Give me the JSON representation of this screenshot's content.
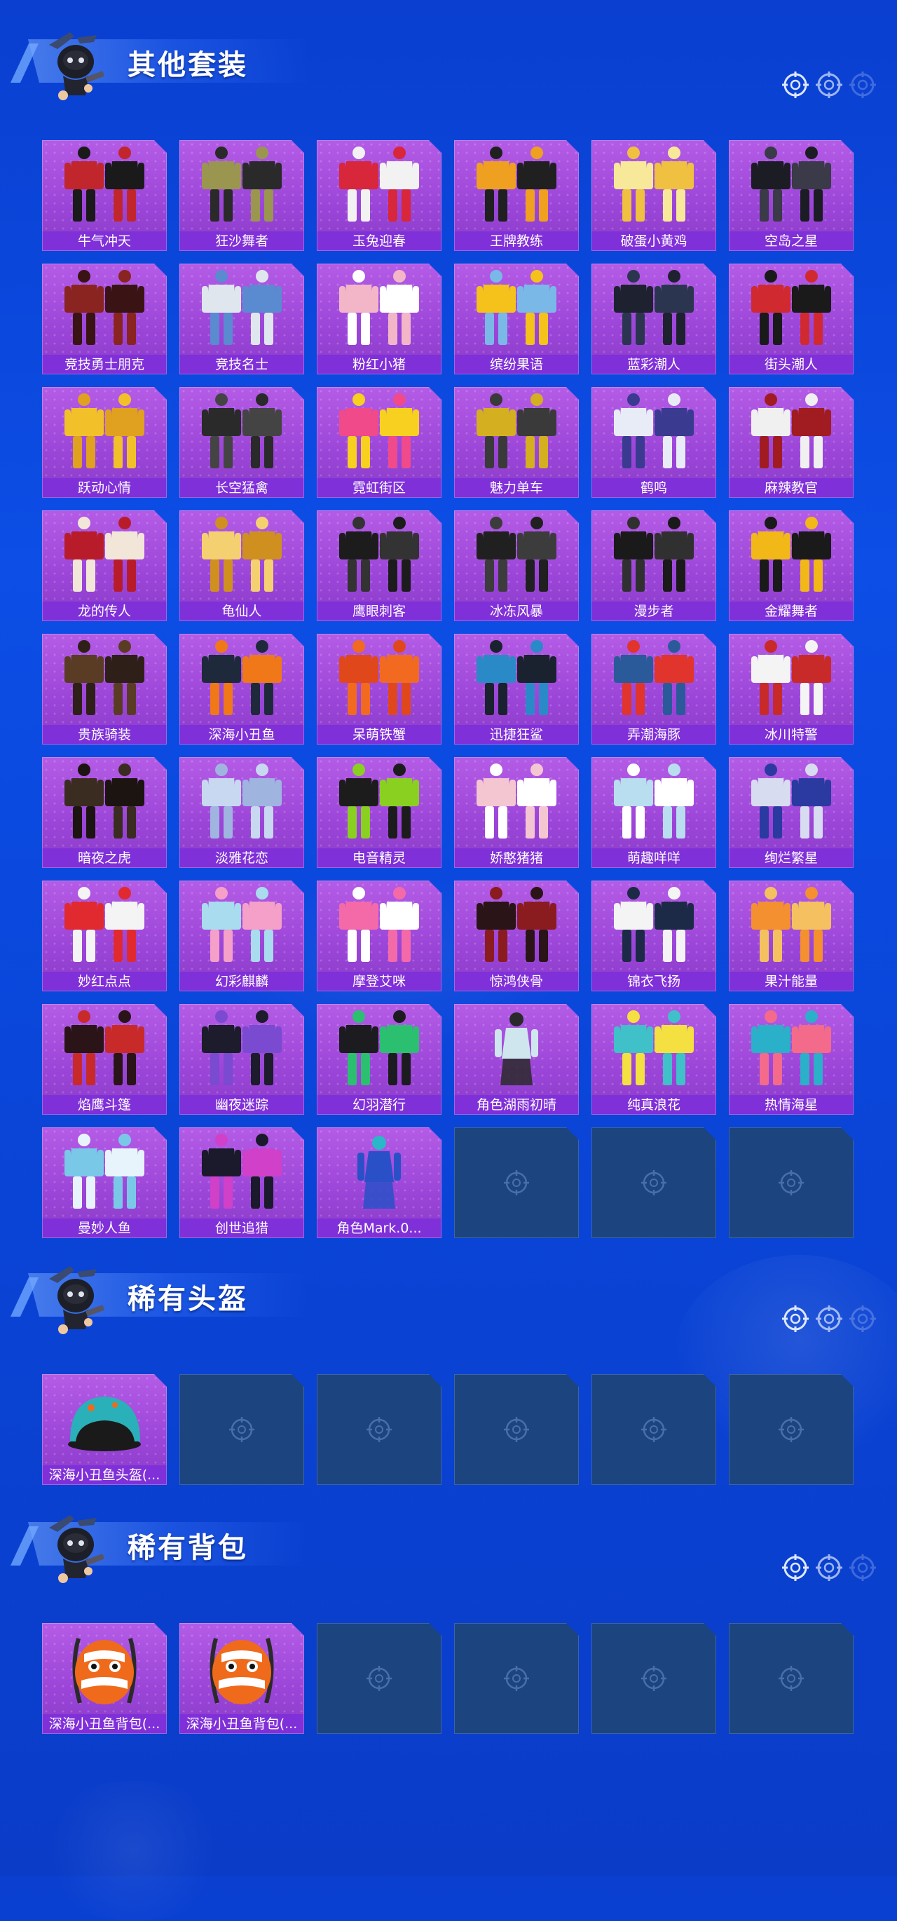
{
  "sections": [
    {
      "id": "suits",
      "title": "其他套装",
      "items": [
        {
          "label": "牛气冲天",
          "icon": "red-black-outfit",
          "primary": "#c0262b",
          "secondary": "#1a1a1a"
        },
        {
          "label": "狂沙舞者",
          "icon": "desert-outfit",
          "primary": "#9a9650",
          "secondary": "#2a2a2a"
        },
        {
          "label": "玉兔迎春",
          "icon": "rabbit-outfit",
          "primary": "#d8263a",
          "secondary": "#f2f2f2"
        },
        {
          "label": "王牌教练",
          "icon": "coach-outfit",
          "primary": "#f0a020",
          "secondary": "#202020"
        },
        {
          "label": "破蛋小黄鸡",
          "icon": "chick-outfit",
          "primary": "#f7e89a",
          "secondary": "#f0c040"
        },
        {
          "label": "空岛之星",
          "icon": "sky-outfit",
          "primary": "#1c1c24",
          "secondary": "#3a3a48"
        },
        {
          "label": "竞技勇士朋克",
          "icon": "punk-coat",
          "primary": "#8a2420",
          "secondary": "#3a1414"
        },
        {
          "label": "竞技名士",
          "icon": "athlete-outfit",
          "primary": "#dfe6ee",
          "secondary": "#5a8ad0"
        },
        {
          "label": "粉红小猪",
          "icon": "pig-outfit",
          "primary": "#f2b6c8",
          "secondary": "#ffffff"
        },
        {
          "label": "缤纷果语",
          "icon": "fruit-outfit",
          "primary": "#f4c21a",
          "secondary": "#7ab8e8"
        },
        {
          "label": "蓝彩潮人",
          "icon": "blue-trend-outfit",
          "primary": "#1e2230",
          "secondary": "#2b3550"
        },
        {
          "label": "街头潮人",
          "icon": "street-outfit",
          "primary": "#d02a30",
          "secondary": "#1a1a1a"
        },
        {
          "label": "跃动心情",
          "icon": "yellow-outfit",
          "primary": "#f2c12a",
          "secondary": "#e0a020"
        },
        {
          "label": "长空猛禽",
          "icon": "leather-jacket",
          "primary": "#2a2a2a",
          "secondary": "#444444"
        },
        {
          "label": "霓虹街区",
          "icon": "neon-outfit",
          "primary": "#f04a8a",
          "secondary": "#f7d020"
        },
        {
          "label": "魅力单车",
          "icon": "bike-outfit",
          "primary": "#d4b020",
          "secondary": "#3a3a3a"
        },
        {
          "label": "鹤鸣",
          "icon": "hoodie",
          "primary": "#e8ecf6",
          "secondary": "#3a3a90"
        },
        {
          "label": "麻辣教官",
          "icon": "instructor-outfit",
          "primary": "#f0f0f0",
          "secondary": "#a01c20"
        },
        {
          "label": "龙的传人",
          "icon": "dragon-outfit",
          "primary": "#b81c2a",
          "secondary": "#f2e6d8"
        },
        {
          "label": "龟仙人",
          "icon": "turtle-shirt",
          "primary": "#f4d070",
          "secondary": "#d09020"
        },
        {
          "label": "鹰眼刺客",
          "icon": "assassin-outfit",
          "primary": "#1c1c1c",
          "secondary": "#333333"
        },
        {
          "label": "冰冻风暴",
          "icon": "storm-outfit",
          "primary": "#202020",
          "secondary": "#3c3c3c"
        },
        {
          "label": "漫步者",
          "icon": "walker-outfit",
          "primary": "#1a1a1a",
          "secondary": "#303030"
        },
        {
          "label": "金耀舞者",
          "icon": "gold-outfit",
          "primary": "#f2b818",
          "secondary": "#1a1a1a"
        },
        {
          "label": "贵族骑装",
          "icon": "noble-outfit",
          "primary": "#5a3c24",
          "secondary": "#2e2018"
        },
        {
          "label": "深海小丑鱼",
          "icon": "clownfish-outfit",
          "primary": "#1e2a3c",
          "secondary": "#f07818"
        },
        {
          "label": "呆萌铁蟹",
          "icon": "crab-outfit",
          "primary": "#e0481c",
          "secondary": "#f26a20"
        },
        {
          "label": "迅捷狂鲨",
          "icon": "shark-outfit",
          "primary": "#2a8ac8",
          "secondary": "#1a2230"
        },
        {
          "label": "弄潮海豚",
          "icon": "dolphin-outfit",
          "primary": "#2a5a9a",
          "secondary": "#e0342c"
        },
        {
          "label": "冰川特警",
          "icon": "glacier-outfit",
          "primary": "#f4f4f4",
          "secondary": "#c82a2a"
        },
        {
          "label": "暗夜之虎",
          "icon": "night-tiger",
          "primary": "#3a2c20",
          "secondary": "#1c1410"
        },
        {
          "label": "淡雅花恋",
          "icon": "floral-dress",
          "primary": "#c8d8f0",
          "secondary": "#a0b4e0"
        },
        {
          "label": "电音精灵",
          "icon": "edm-outfit",
          "primary": "#1c1c1c",
          "secondary": "#8ad020"
        },
        {
          "label": "娇憨猪猪",
          "icon": "cute-pig",
          "primary": "#f4c6d2",
          "secondary": "#ffffff"
        },
        {
          "label": "萌趣咩咩",
          "icon": "sheep-outfit",
          "primary": "#b8def0",
          "secondary": "#ffffff"
        },
        {
          "label": "绚烂繁星",
          "icon": "star-outfit",
          "primary": "#d8dcf0",
          "secondary": "#2a3aa0"
        },
        {
          "label": "妙红点点",
          "icon": "red-dots",
          "primary": "#e02a30",
          "secondary": "#f4f4f4"
        },
        {
          "label": "幻彩麒麟",
          "icon": "qilin-outfit",
          "primary": "#a8dcee",
          "secondary": "#f4a0c8"
        },
        {
          "label": "摩登艾咪",
          "icon": "modern-outfit",
          "primary": "#f46aa8",
          "secondary": "#ffffff"
        },
        {
          "label": "惊鸿侠骨",
          "icon": "hero-robe",
          "primary": "#2a1418",
          "secondary": "#8a1c20"
        },
        {
          "label": "锦衣飞扬",
          "icon": "brocade-robe",
          "primary": "#f4f4f4",
          "secondary": "#1c2a48"
        },
        {
          "label": "果汁能量",
          "icon": "juice-outfit",
          "primary": "#f49030",
          "secondary": "#f4c060"
        },
        {
          "label": "焰鹰斗篷",
          "icon": "flame-cloak",
          "primary": "#2a1418",
          "secondary": "#c82a2a"
        },
        {
          "label": "幽夜迷踪",
          "icon": "night-trail",
          "primary": "#1c1c2c",
          "secondary": "#7a4ad0"
        },
        {
          "label": "幻羽潜行",
          "icon": "feather-stealth",
          "primary": "#1c1c20",
          "secondary": "#2ac070"
        },
        {
          "label": "角色湖雨初晴",
          "icon": "character-figure",
          "primary": "#cfe6ef",
          "secondary": "#2a2a2a"
        },
        {
          "label": "纯真浪花",
          "icon": "wave-outfit",
          "primary": "#40c0c8",
          "secondary": "#f4e040"
        },
        {
          "label": "热情海星",
          "icon": "starfish-outfit",
          "primary": "#2ab0c8",
          "secondary": "#f46a8a"
        },
        {
          "label": "曼妙人鱼",
          "icon": "mermaid-outfit",
          "primary": "#7ac8e8",
          "secondary": "#e8f4fc"
        },
        {
          "label": "创世追猎",
          "icon": "genesis-outfit",
          "primary": "#1a1a2c",
          "secondary": "#d040c8"
        },
        {
          "label": "角色Mark.0...",
          "icon": "mech-figure",
          "primary": "#2a50c8",
          "secondary": "#2ab8c8"
        }
      ],
      "empty_slots": 3
    },
    {
      "id": "helmets",
      "title": "稀有头盔",
      "items": [
        {
          "label": "深海小丑鱼头盔(...",
          "icon": "helmet",
          "primary": "#2ab0b8",
          "secondary": "#1a1a1a"
        }
      ],
      "empty_slots": 5
    },
    {
      "id": "backpacks",
      "title": "稀有背包",
      "items": [
        {
          "label": "深海小丑鱼背包(...",
          "icon": "backpack",
          "primary": "#f06a1c",
          "secondary": "#ffffff"
        },
        {
          "label": "深海小丑鱼背包(...",
          "icon": "backpack",
          "primary": "#f06a1c",
          "secondary": "#ffffff"
        }
      ],
      "empty_slots": 4
    }
  ],
  "colors": {
    "background": "#0c4ee6",
    "tile_purple": "#a651dd",
    "label_bar": "#8030d8",
    "empty_tile": "#1c447e"
  }
}
